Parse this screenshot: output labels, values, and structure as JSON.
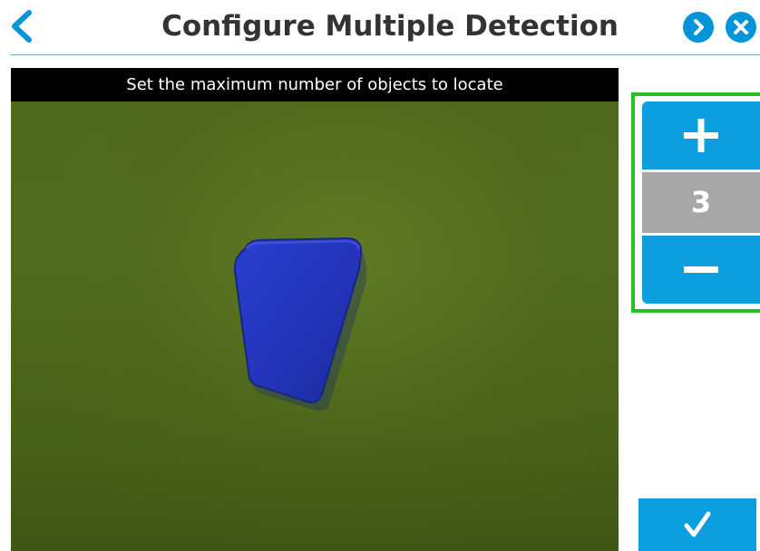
{
  "header": {
    "title": "Configure Multiple Detection",
    "back_icon": "chevron-left-icon",
    "play_icon": "play-icon",
    "close_icon": "close-icon"
  },
  "camera": {
    "instruction": "Set the maximum number of objects to locate"
  },
  "stepper": {
    "value": "3",
    "increment_icon": "plus-icon",
    "decrement_icon": "minus-icon"
  },
  "confirm": {
    "icon": "checkmark-icon"
  },
  "colors": {
    "accent": "#0d9ee0",
    "highlight_border": "#22c31e",
    "value_background": "#a7a7a7",
    "title_text": "#333333"
  }
}
